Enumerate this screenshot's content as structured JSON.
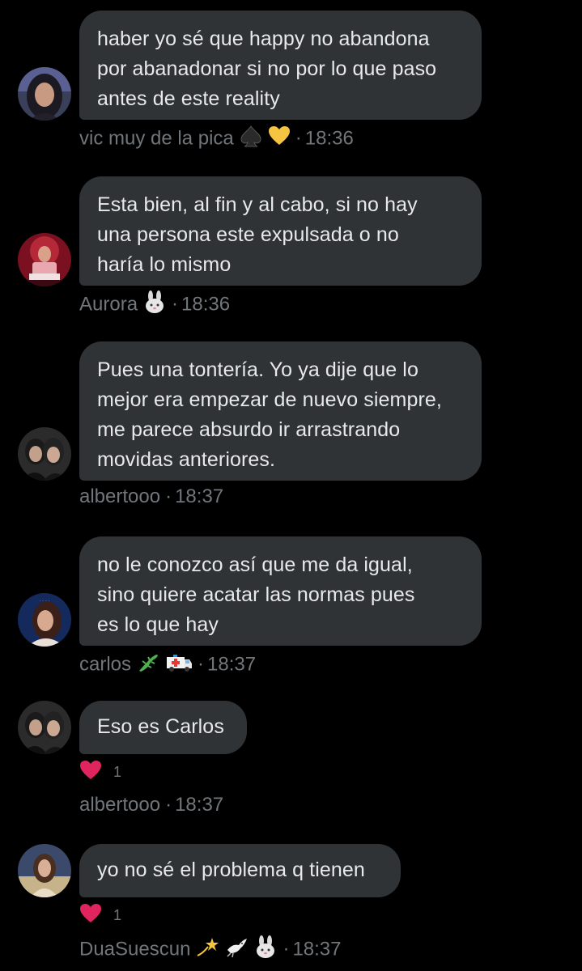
{
  "messages": [
    {
      "lines": [
        "haber yo sé que happy no abandona",
        "por abanadonar si no por lo que paso",
        "antes de este reality"
      ],
      "author": "vic muy de la pica",
      "author_emojis": [
        "spade-icon",
        "yellow-heart-icon"
      ],
      "separator": "·",
      "time": "18:36"
    },
    {
      "lines": [
        "Esta bien, al fin y al cabo, si no hay",
        "una persona este expulsada o no",
        "haría lo mismo"
      ],
      "author": "Aurora",
      "author_emojis": [
        "rabbit-icon"
      ],
      "separator": "·",
      "time": "18:36"
    },
    {
      "lines": [
        "Pues una tontería. Yo ya dije que lo",
        "mejor era empezar de nuevo siempre,",
        "me parece absurdo ir arrastrando",
        "movidas anteriores."
      ],
      "author": "albertooo",
      "author_emojis": [],
      "separator": "·",
      "time": "18:37"
    },
    {
      "lines": [
        "no le conozco así que me da igual,",
        "sino quiere acatar las normas pues",
        "es lo que hay"
      ],
      "author": "carlos",
      "author_emojis": [
        "lizard-icon",
        "ambulance-icon"
      ],
      "separator": "·",
      "time": "18:37"
    },
    {
      "lines": [
        "Eso es Carlos"
      ],
      "reaction": {
        "icon": "red-heart-icon",
        "count": "1"
      },
      "author": "albertooo",
      "author_emojis": [],
      "separator": "·",
      "time": "18:37"
    },
    {
      "lines": [
        "yo no sé el problema q tienen"
      ],
      "reaction": {
        "icon": "red-heart-icon",
        "count": "1"
      },
      "author": "DuaSuescun",
      "author_emojis": [
        "dizzy-icon",
        "dove-icon",
        "rabbit-icon"
      ],
      "separator": "·",
      "time": "18:37"
    }
  ],
  "colors": {
    "background": "#000000",
    "bubble": "#2f3336",
    "text": "#e7e9ea",
    "meta": "#71767b",
    "heart": "#e0245e"
  }
}
